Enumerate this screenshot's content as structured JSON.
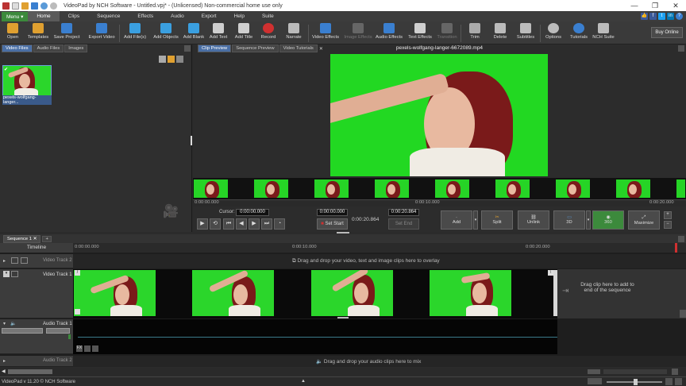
{
  "window": {
    "title": "VideoPad by NCH Software - Untitled.vpj* - (Unlicensed) Non-commercial home use only",
    "controls": [
      "—",
      "❐",
      "✕"
    ]
  },
  "menu": {
    "menu_button": "Menu ▾",
    "tabs": [
      "Home",
      "Clips",
      "Sequence",
      "Effects",
      "Audio",
      "Export",
      "Help",
      "Suite"
    ],
    "active_tab": "Home"
  },
  "ribbon": {
    "buttons": [
      {
        "label": "Open",
        "color": "#e0a030"
      },
      {
        "label": "Templates",
        "color": "#e0a030"
      },
      {
        "label": "Save Project",
        "color": "#3a7fd0"
      },
      {
        "label": "Export Video",
        "color": "#3a7fd0"
      },
      {
        "label": "Add File(s)",
        "color": "#3a9fe0"
      },
      {
        "label": "Add Objects",
        "color": "#3a9fe0"
      },
      {
        "label": "Add Blank",
        "color": "#3a9fe0"
      },
      {
        "label": "Add Text",
        "color": "#cccccc"
      },
      {
        "label": "Add Title",
        "color": "#cccccc"
      },
      {
        "label": "Record",
        "color": "#d03030"
      },
      {
        "label": "Narrate",
        "color": "#cccccc"
      },
      {
        "label": "Video Effects",
        "color": "#3a7fd0"
      },
      {
        "label": "Image Effects",
        "color": "#777777"
      },
      {
        "label": "Audio Effects",
        "color": "#3a7fd0"
      },
      {
        "label": "Text Effects",
        "color": "#cccccc"
      },
      {
        "label": "Transition",
        "color": "#777777"
      },
      {
        "label": "Trim",
        "color": "#cccccc"
      },
      {
        "label": "Delete",
        "color": "#cccccc"
      },
      {
        "label": "Subtitles",
        "color": "#cccccc"
      },
      {
        "label": "Options",
        "color": "#cccccc"
      },
      {
        "label": "Tutorials",
        "color": "#3a7fd0"
      },
      {
        "label": "NCH Suite",
        "color": "#cccccc"
      }
    ],
    "buy_online": "Buy Online"
  },
  "media_panel": {
    "tabs": [
      "Video Files",
      "Audio Files",
      "Images"
    ],
    "active_tab": "Video Files",
    "file_caption": "pexels-wolfgang-langer..."
  },
  "preview": {
    "tabs": [
      "Clip Preview",
      "Sequence Preview",
      "Video Tutorials"
    ],
    "active_tab": "Clip Preview",
    "clip_name": "pexels-wolfgang-langer-6672089.mp4",
    "ruler_start": "0:00:00.000",
    "ruler_mid": "0:00:10.000",
    "ruler_end": "0:00:20.000",
    "cursor_label": "Cursor:",
    "cursor_value": "0:00:00.000",
    "start_value": "0:00:00.000",
    "set_start": "Set Start",
    "duration": "0:00:20.864",
    "end_value": "0:00:20.864",
    "set_end": "Set End",
    "actions": [
      "Add",
      "Split",
      "Unlink",
      "3D",
      "360",
      "Maximize"
    ]
  },
  "timeline": {
    "sequence_tab": "Sequence 1",
    "label": "Timeline",
    "ruler": [
      "0:00:00.000",
      "0:00:10.000",
      "0:00:20.000"
    ],
    "tracks": {
      "video2": "Video Track 2",
      "video1": "Video Track 1",
      "audio1": "Audio Track 1",
      "audio2": "Audio Track 2"
    },
    "overlay_hint": "Drag and drop your video, text and image clips here to overlay",
    "append_hint": "Drag clip here to add to end of the sequence",
    "audio_hint": "Drag and drop your audio clips here to mix"
  },
  "status": {
    "text": "VideoPad v 11.20 © NCH Software"
  }
}
